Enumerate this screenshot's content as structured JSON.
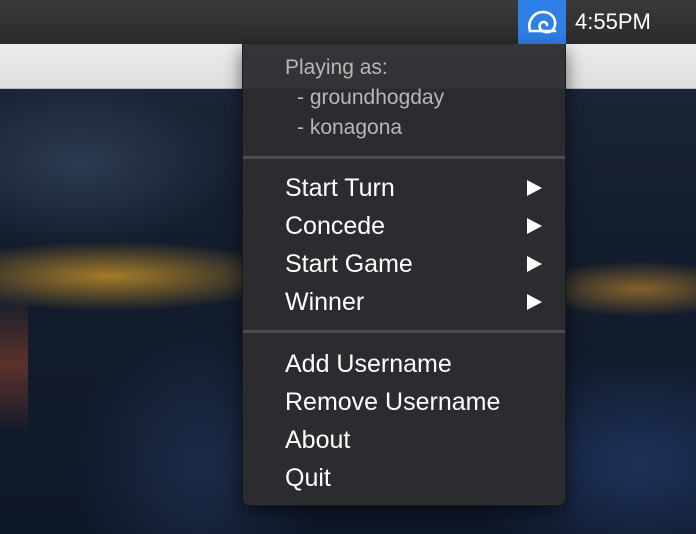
{
  "menubar": {
    "status_icon": "swirl-app-icon",
    "clock": "4:55PM",
    "status_highlight_color": "#2f7fe8"
  },
  "menu": {
    "playing_as_label": "Playing as:",
    "users": [
      "- groundhogday",
      "- konagona"
    ],
    "game_actions": [
      {
        "label": "Start Turn",
        "submenu": true
      },
      {
        "label": "Concede",
        "submenu": true
      },
      {
        "label": "Start Game",
        "submenu": true
      },
      {
        "label": "Winner",
        "submenu": true
      }
    ],
    "app_actions": [
      {
        "label": "Add Username"
      },
      {
        "label": "Remove Username"
      },
      {
        "label": "About"
      },
      {
        "label": "Quit"
      }
    ],
    "submenu_icon": "triangle-right-icon"
  }
}
